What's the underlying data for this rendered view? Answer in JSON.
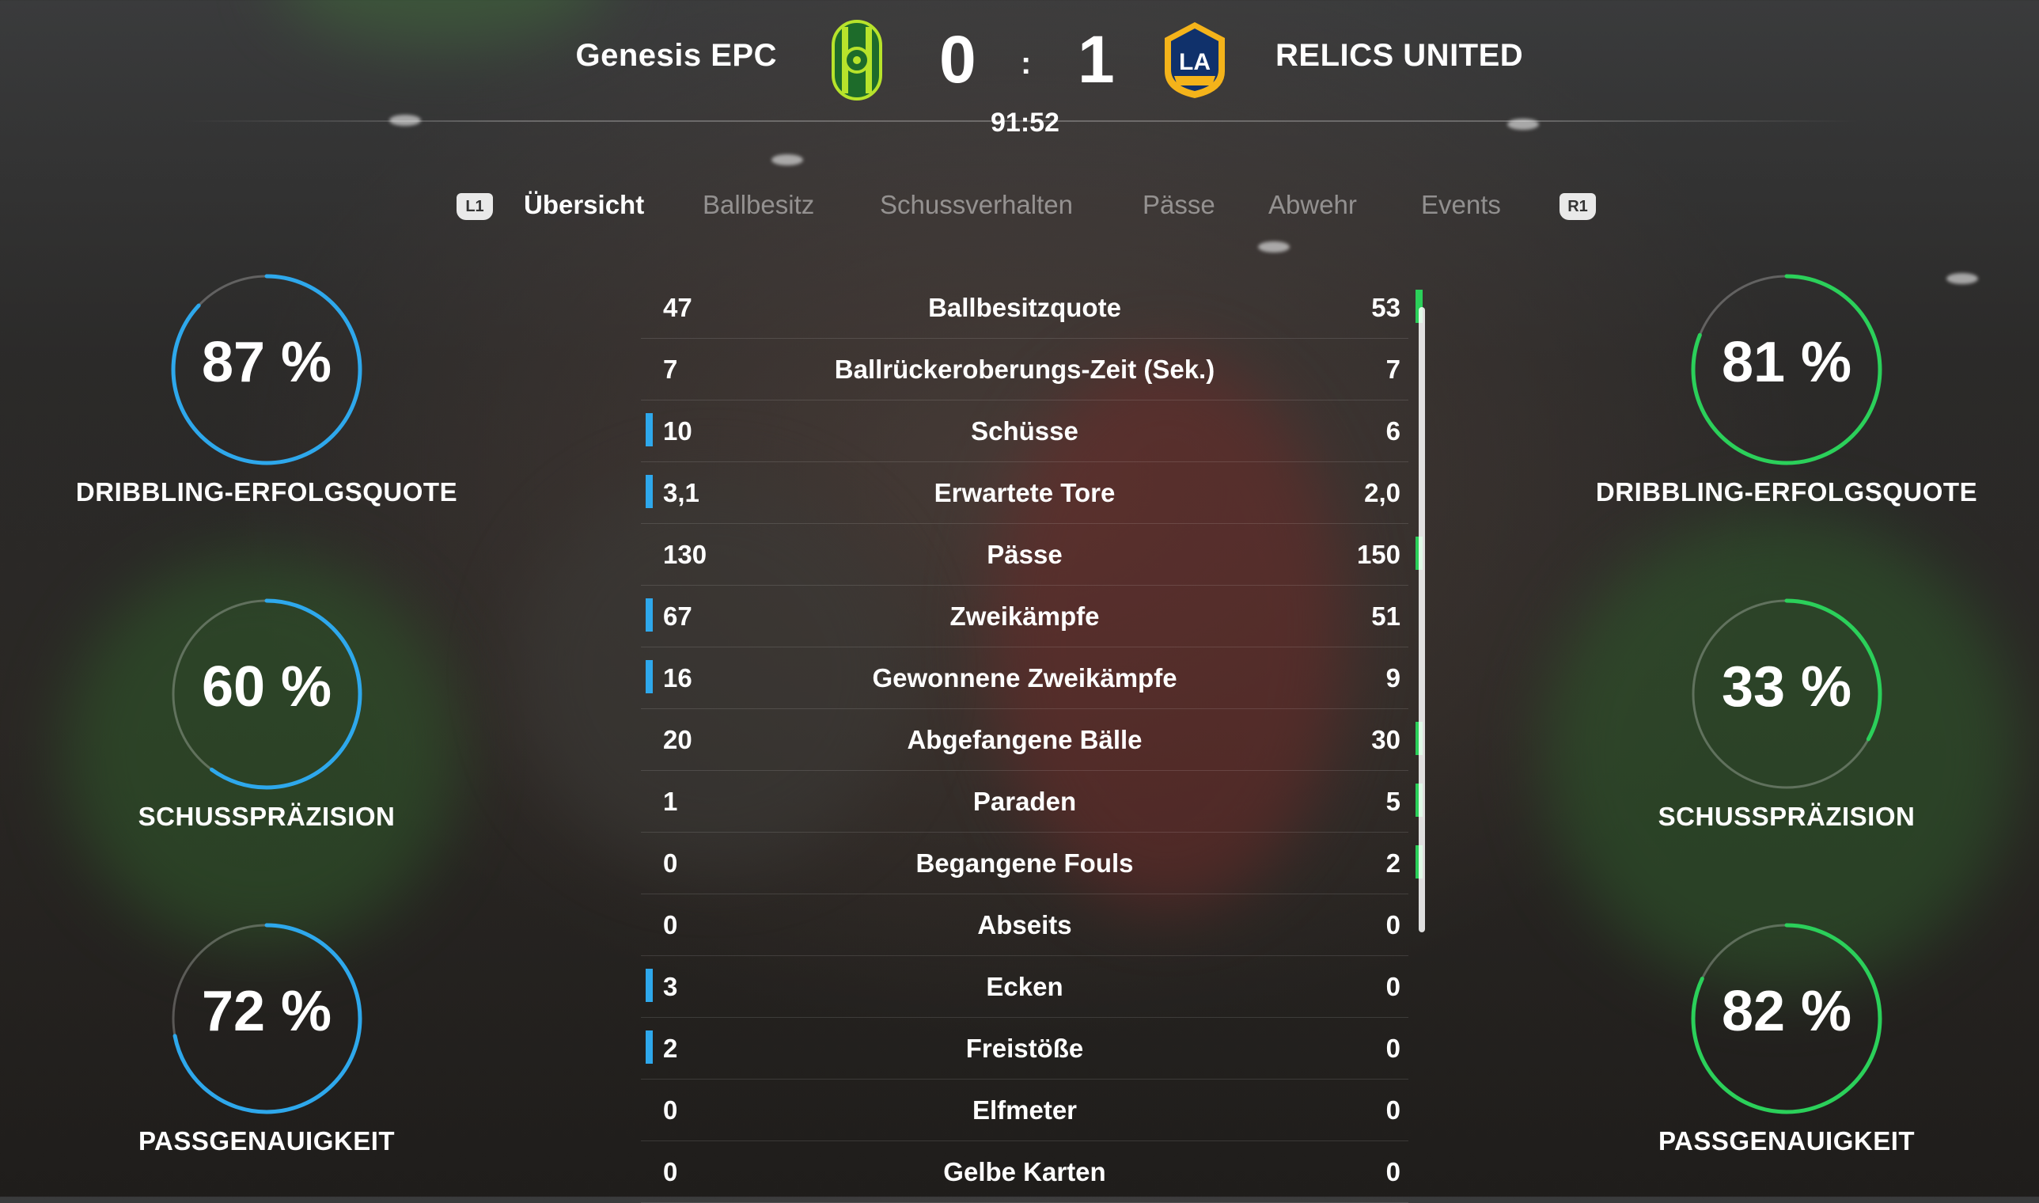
{
  "header": {
    "home_team": "Genesis EPC",
    "away_team": "RELICS UNITED",
    "home_score": "0",
    "separator": ":",
    "away_score": "1",
    "match_time": "91:52",
    "away_crest_text": "LA"
  },
  "tabs": {
    "left_shoulder": "L1",
    "right_shoulder": "R1",
    "items": [
      {
        "label": "Übersicht",
        "active": true
      },
      {
        "label": "Ballbesitz",
        "active": false
      },
      {
        "label": "Schussverhalten",
        "active": false
      },
      {
        "label": "Pässe",
        "active": false
      },
      {
        "label": "Abwehr",
        "active": false
      },
      {
        "label": "Events",
        "active": false
      }
    ]
  },
  "colors": {
    "home_accent": "#2ea8ec",
    "away_accent": "#2bd05a"
  },
  "stats": [
    {
      "label": "Ballbesitzquote",
      "home": "47",
      "away": "53",
      "leader": "away"
    },
    {
      "label": "Ballrückeroberungs-Zeit (Sek.)",
      "home": "7",
      "away": "7",
      "leader": ""
    },
    {
      "label": "Schüsse",
      "home": "10",
      "away": "6",
      "leader": "home"
    },
    {
      "label": "Erwartete Tore",
      "home": "3,1",
      "away": "2,0",
      "leader": "home"
    },
    {
      "label": "Pässe",
      "home": "130",
      "away": "150",
      "leader": "away"
    },
    {
      "label": "Zweikämpfe",
      "home": "67",
      "away": "51",
      "leader": "home"
    },
    {
      "label": "Gewonnene Zweikämpfe",
      "home": "16",
      "away": "9",
      "leader": "home"
    },
    {
      "label": "Abgefangene Bälle",
      "home": "20",
      "away": "30",
      "leader": "away"
    },
    {
      "label": "Paraden",
      "home": "1",
      "away": "5",
      "leader": "away"
    },
    {
      "label": "Begangene Fouls",
      "home": "0",
      "away": "2",
      "leader": "away"
    },
    {
      "label": "Abseits",
      "home": "0",
      "away": "0",
      "leader": ""
    },
    {
      "label": "Ecken",
      "home": "3",
      "away": "0",
      "leader": "home"
    },
    {
      "label": "Freistöße",
      "home": "2",
      "away": "0",
      "leader": "home"
    },
    {
      "label": "Elfmeter",
      "home": "0",
      "away": "0",
      "leader": ""
    },
    {
      "label": "Gelbe Karten",
      "home": "0",
      "away": "0",
      "leader": ""
    }
  ],
  "gauges": {
    "home": [
      {
        "value": "87 %",
        "percent": 87,
        "label": "DRIBBLING-ERFOLGSQUOTE"
      },
      {
        "value": "60 %",
        "percent": 60,
        "label": "SCHUSSPRÄZISION"
      },
      {
        "value": "72 %",
        "percent": 72,
        "label": "PASSGENAUIGKEIT"
      }
    ],
    "away": [
      {
        "value": "81 %",
        "percent": 81,
        "label": "DRIBBLING-ERFOLGSQUOTE"
      },
      {
        "value": "33 %",
        "percent": 33,
        "label": "SCHUSSPRÄZISION"
      },
      {
        "value": "82 %",
        "percent": 82,
        "label": "PASSGENAUIGKEIT"
      }
    ]
  }
}
